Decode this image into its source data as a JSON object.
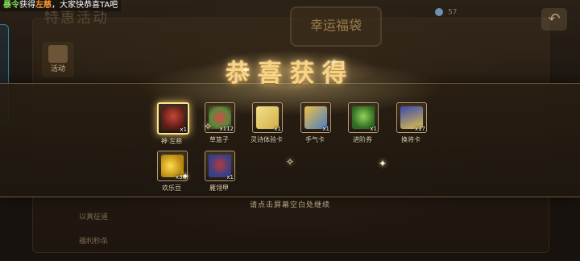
{
  "ticker": {
    "player_name": "暴令",
    "verb": "获得",
    "item": "左慈",
    "message": "，大家快恭喜TA吧"
  },
  "background": {
    "section_title": "特惠活动",
    "sign": "幸运福袋",
    "side_tab_label": "活动",
    "list_items": [
      "福利秒杀",
      "以真征道"
    ],
    "top_stat": "57"
  },
  "reward_popup": {
    "title": "恭喜获得",
    "items": [
      {
        "name": "神·左慈",
        "qty": "x1",
        "icon": "general-portrait-icon",
        "highlight": true
      },
      {
        "name": "草篮子",
        "qty": "x112",
        "icon": "flower-basket-icon",
        "highlight": false
      },
      {
        "name": "灵诗体验卡",
        "qty": "x1",
        "icon": "experience-card-icon",
        "highlight": false
      },
      {
        "name": "手气卡",
        "qty": "x1",
        "icon": "luck-card-icon",
        "highlight": false
      },
      {
        "name": "进阶券",
        "qty": "x1",
        "icon": "advance-ticket-icon",
        "highlight": false
      },
      {
        "name": "换将卡",
        "qty": "x17",
        "icon": "swap-general-card-icon",
        "highlight": false
      },
      {
        "name": "欢乐豆",
        "qty": "x30",
        "icon": "joy-beans-icon",
        "highlight": false
      },
      {
        "name": "雁翎甲",
        "qty": "x1",
        "icon": "armor-icon",
        "highlight": false
      }
    ],
    "hint": "请点击屏幕空白处继续"
  },
  "colors": {
    "title_gold": "#f6d48a",
    "ticker_name": "#7ed957",
    "ticker_item": "#ff9b2f"
  }
}
